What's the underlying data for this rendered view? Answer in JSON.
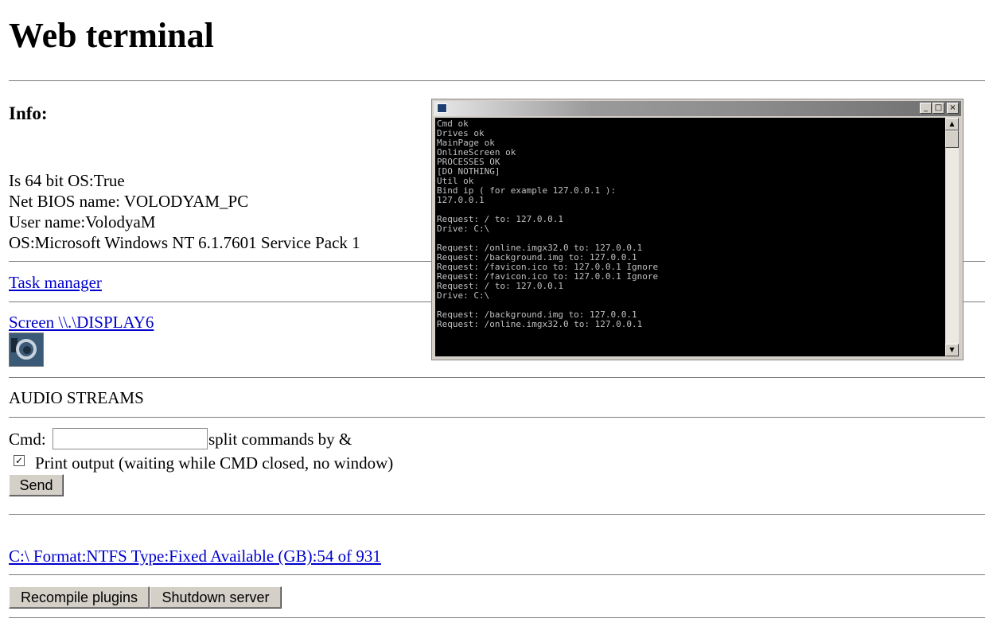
{
  "page": {
    "title": "Web terminal"
  },
  "info": {
    "heading": "Info:",
    "lines": [
      "Is 64 bit OS:True",
      "Net BIOS name: VOLODYAM_PC",
      "User name:VolodyaM",
      "OS:Microsoft Windows NT 6.1.7601 Service Pack 1"
    ]
  },
  "links": {
    "task_manager": "Task manager",
    "screen": "Screen \\\\.\\DISPLAY6",
    "drive": "C:\\ Format:NTFS Type:Fixed Available (GB):54 of 931"
  },
  "audio": {
    "label": "AUDIO STREAMS"
  },
  "cmd": {
    "label": "Cmd:",
    "value": "",
    "hint": "split commands by &",
    "print_output_label": "Print output (waiting while CMD closed, no window)",
    "print_output_checked": true,
    "send_label": "Send"
  },
  "buttons": {
    "recompile": "Recompile plugins",
    "shutdown": "Shutdown server"
  },
  "console": {
    "lines": [
      "Cmd ok",
      "Drives ok",
      "MainPage ok",
      "OnlineScreen ok",
      "PROCESSES OK",
      "[DO NOTHING]",
      "Util ok",
      "Bind ip ( for example 127.0.0.1 ):",
      "127.0.0.1",
      "",
      "Request: / to: 127.0.0.1",
      "Drive: C:\\",
      "",
      "Request: /online.imgx32.0 to: 127.0.0.1",
      "Request: /background.img to: 127.0.0.1",
      "Request: /favicon.ico to: 127.0.0.1 Ignore",
      "Request: /favicon.ico to: 127.0.0.1 Ignore",
      "Request: / to: 127.0.0.1",
      "Drive: C:\\",
      "",
      "Request: /background.img to: 127.0.0.1",
      "Request: /online.imgx32.0 to: 127.0.0.1"
    ]
  }
}
